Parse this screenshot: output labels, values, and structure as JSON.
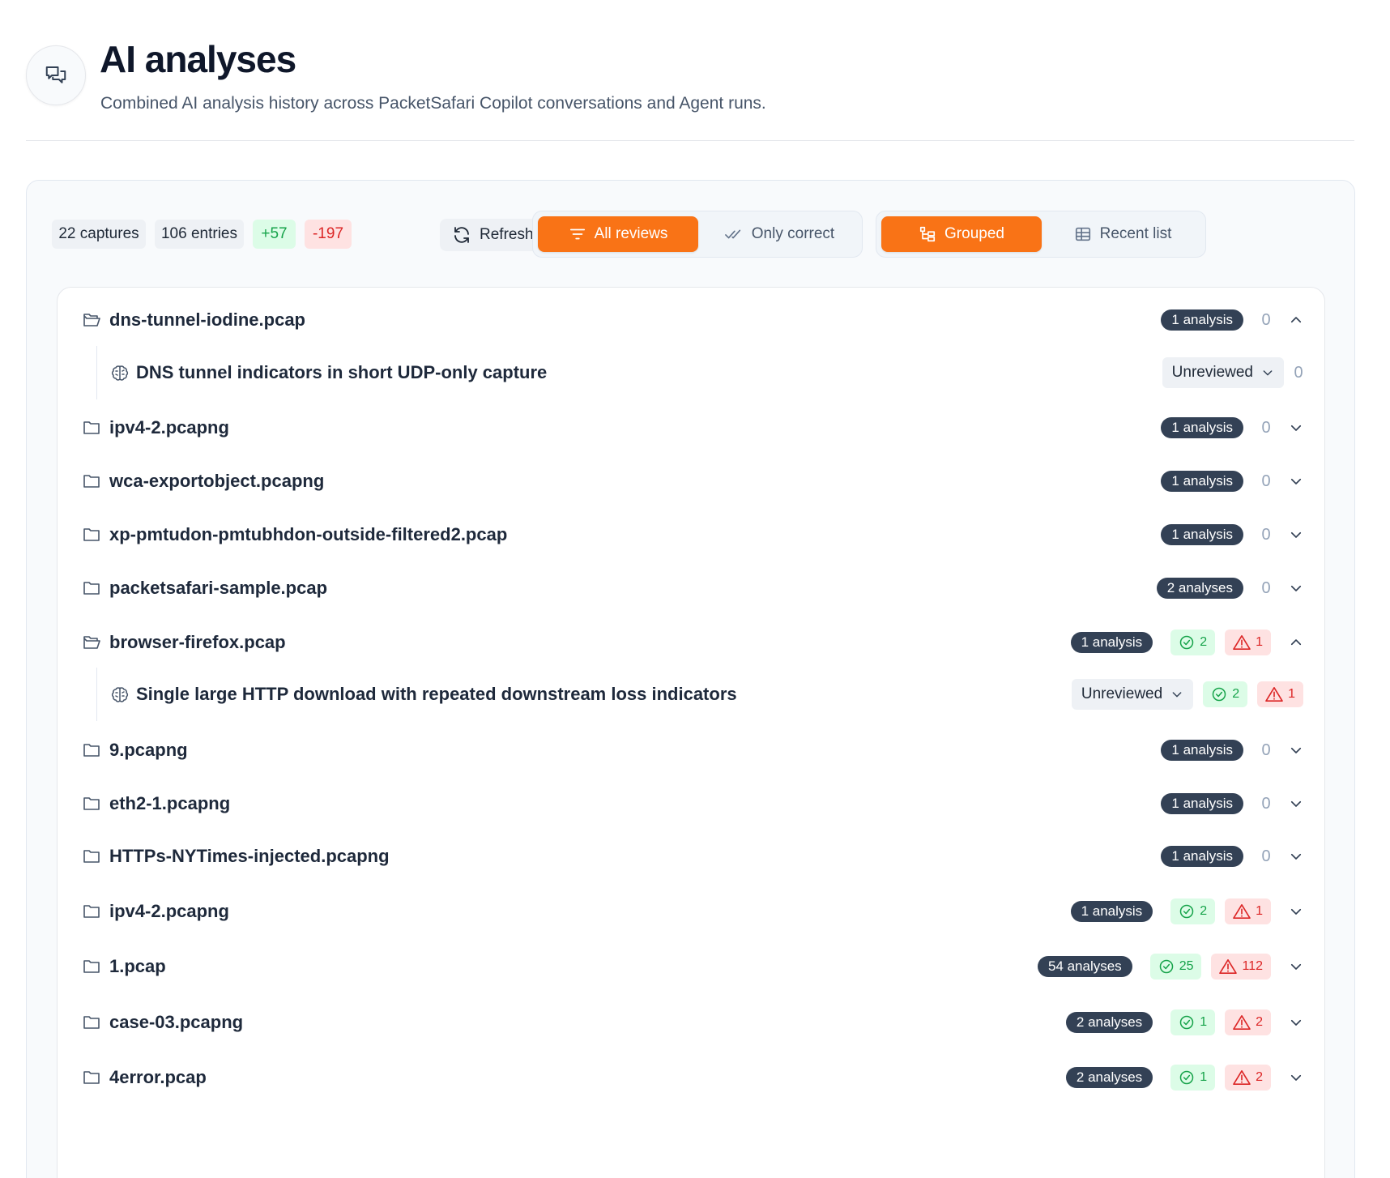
{
  "header": {
    "title": "AI analyses",
    "subtitle": "Combined AI analysis history across PacketSafari Copilot conversations and Agent runs.",
    "icon": "chat-bubbles-icon"
  },
  "toolbar": {
    "captures": "22 captures",
    "entries": "106 entries",
    "positive": "+57",
    "negative": "-197",
    "refresh_label": "Refresh",
    "filter": {
      "all_reviews": "All reviews",
      "only_correct": "Only correct",
      "active": "All reviews"
    },
    "view": {
      "grouped": "Grouped",
      "recent_list": "Recent list",
      "active": "Grouped"
    }
  },
  "colors": {
    "accent": "#f97316",
    "positive": "#16a34a",
    "negative": "#dc2626",
    "badge": "#334155"
  },
  "groups": [
    {
      "name": "dns-tunnel-iodine.pcap",
      "count": "1 analysis",
      "score": "0",
      "expanded": true,
      "children": [
        {
          "title": "DNS tunnel indicators in short UDP-only capture",
          "review": "Unreviewed",
          "score": "0"
        }
      ]
    },
    {
      "name": "ipv4-2.pcapng",
      "count": "1 analysis",
      "score": "0",
      "expanded": false
    },
    {
      "name": "wca-exportobject.pcapng",
      "count": "1 analysis",
      "score": "0",
      "expanded": false
    },
    {
      "name": "xp-pmtudon-pmtubhdon-outside-filtered2.pcap",
      "count": "1 analysis",
      "score": "0",
      "expanded": false
    },
    {
      "name": "packetsafari-sample.pcap",
      "count": "2 analyses",
      "score": "0",
      "expanded": false
    },
    {
      "name": "browser-firefox.pcap",
      "count": "1 analysis",
      "ok": "2",
      "warn": "1",
      "expanded": true,
      "children": [
        {
          "title": "Single large HTTP download with repeated downstream loss indicators",
          "review": "Unreviewed",
          "ok": "2",
          "warn": "1"
        }
      ]
    },
    {
      "name": "9.pcapng",
      "count": "1 analysis",
      "score": "0",
      "expanded": false
    },
    {
      "name": "eth2-1.pcapng",
      "count": "1 analysis",
      "score": "0",
      "expanded": false
    },
    {
      "name": "HTTPs-NYTimes-injected.pcapng",
      "count": "1 analysis",
      "score": "0",
      "expanded": false
    },
    {
      "name": "ipv4-2.pcapng",
      "count": "1 analysis",
      "ok": "2",
      "warn": "1",
      "expanded": false
    },
    {
      "name": "1.pcap",
      "count": "54 analyses",
      "ok": "25",
      "warn": "112",
      "expanded": false
    },
    {
      "name": "case-03.pcapng",
      "count": "2 analyses",
      "ok": "1",
      "warn": "2",
      "expanded": false
    },
    {
      "name": "4error.pcap",
      "count": "2 analyses",
      "ok": "1",
      "warn": "2",
      "expanded": false
    }
  ]
}
